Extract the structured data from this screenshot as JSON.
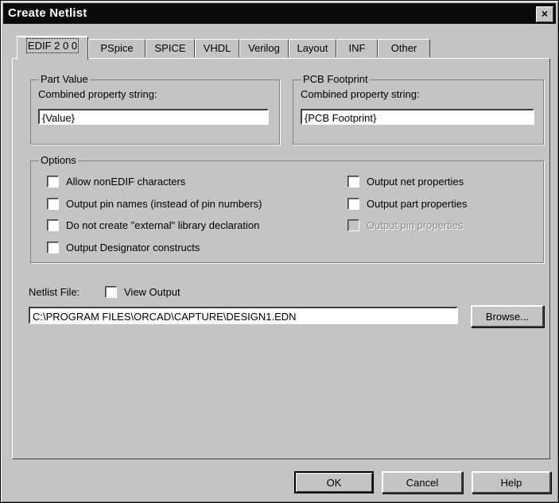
{
  "window": {
    "title": "Create Netlist",
    "close_label": "×"
  },
  "tabs": [
    {
      "label": "EDIF 2 0 0",
      "active": true
    },
    {
      "label": "PSpice"
    },
    {
      "label": "SPICE"
    },
    {
      "label": "VHDL"
    },
    {
      "label": "Verilog"
    },
    {
      "label": "Layout"
    },
    {
      "label": "INF"
    },
    {
      "label": "Other"
    }
  ],
  "part_value": {
    "legend": "Part Value",
    "label": "Combined property string:",
    "value": "{Value}"
  },
  "pcb_footprint": {
    "legend": "PCB Footprint",
    "label": "Combined property string:",
    "value": "{PCB Footprint}"
  },
  "options": {
    "legend": "Options",
    "left": [
      {
        "label": "Allow nonEDIF characters",
        "checked": false
      },
      {
        "label": "Output pin names (instead of pin numbers)",
        "checked": false
      },
      {
        "label": "Do not create \"external\" library declaration",
        "checked": false
      },
      {
        "label": "Output Designator constructs",
        "checked": false
      }
    ],
    "right": [
      {
        "label": "Output net properties",
        "checked": false,
        "enabled": true
      },
      {
        "label": "Output part properties",
        "checked": false,
        "enabled": true
      },
      {
        "label": "Output pin properties",
        "checked": false,
        "enabled": false
      }
    ]
  },
  "netlist": {
    "label": "Netlist File:",
    "view_output_label": "View Output",
    "view_output_checked": false,
    "path": "C:\\PROGRAM FILES\\ORCAD\\CAPTURE\\DESIGN1.EDN",
    "browse_label": "Browse..."
  },
  "buttons": {
    "ok": "OK",
    "cancel": "Cancel",
    "help": "Help"
  }
}
